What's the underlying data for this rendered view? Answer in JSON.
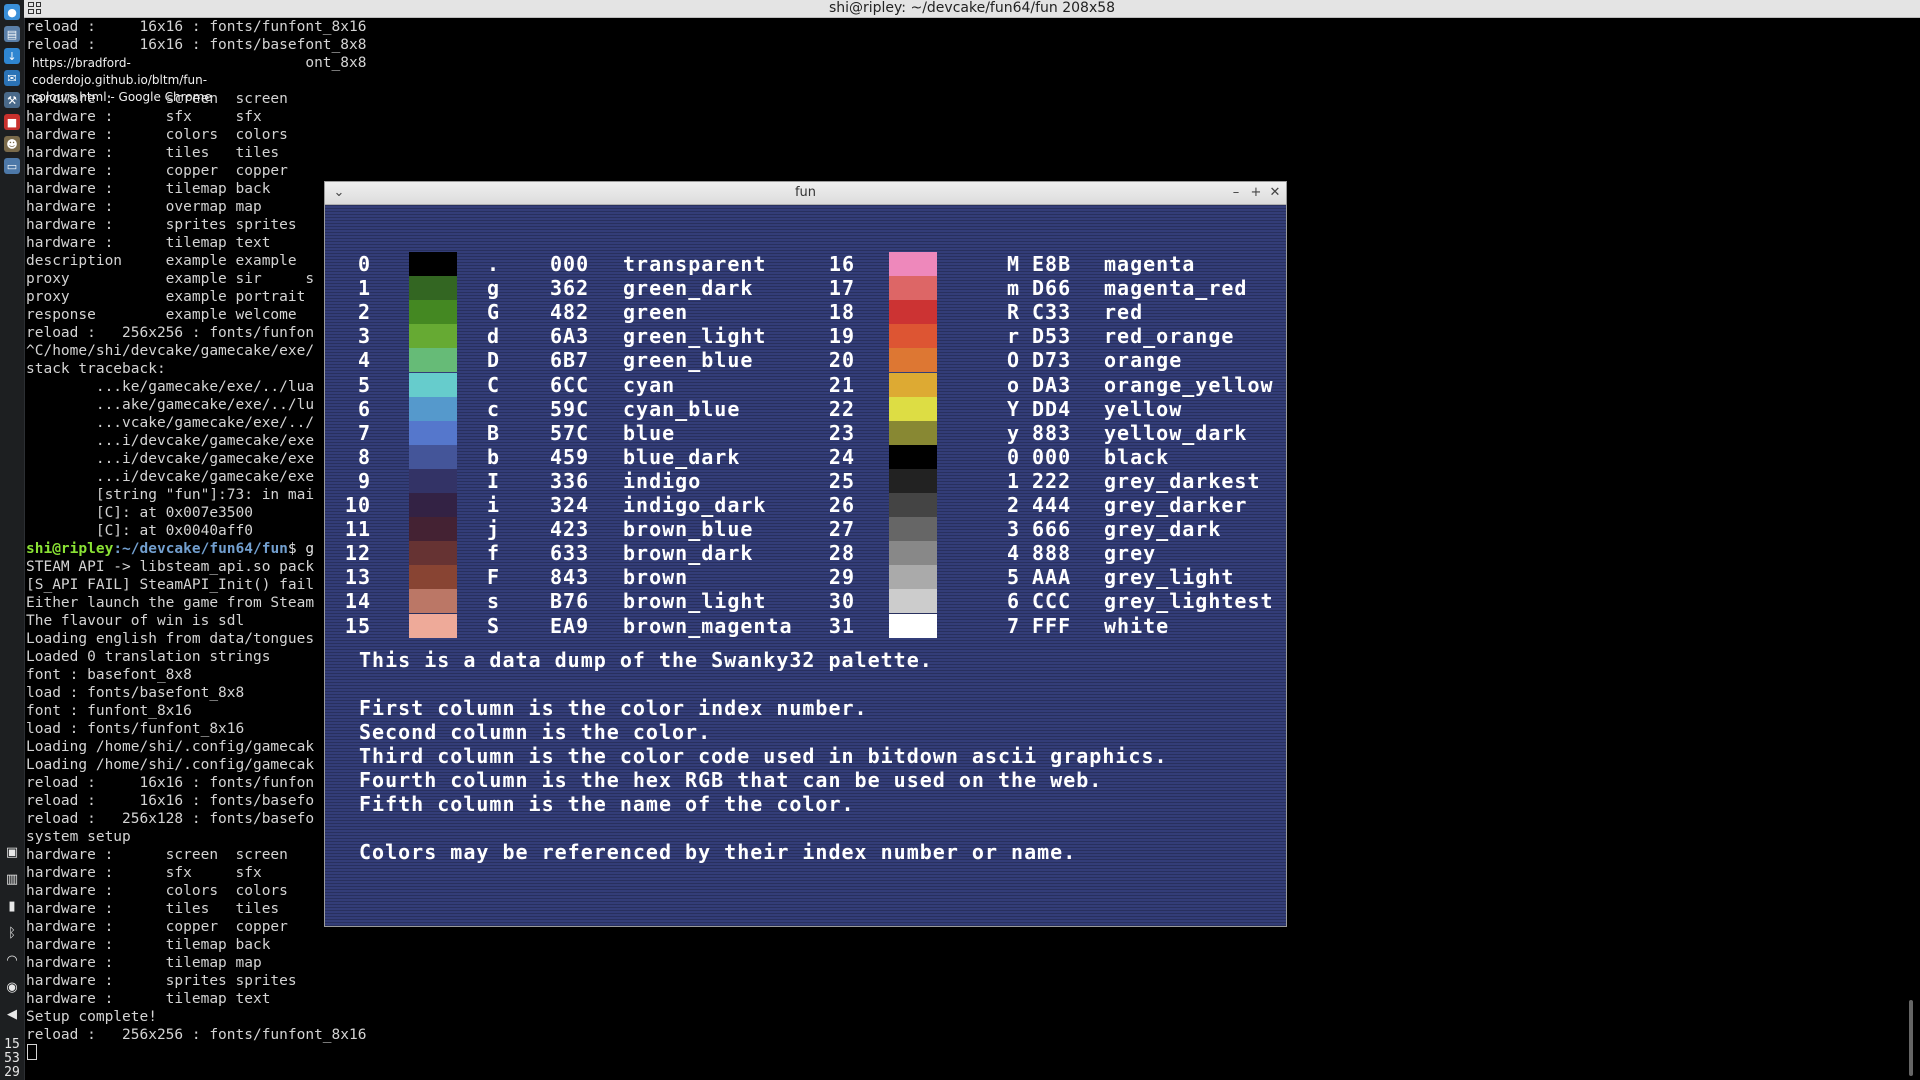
{
  "terminal": {
    "title": "shi@ripley: ~/devcake/fun64/fun 208x58",
    "lines": [
      "reload :     16x16 : fonts/funfont_8x16",
      "reload :     16x16 : fonts/basefont_8x8",
      "reload :   256x128 : fonts/basefont_8x8",
      "system setup",
      "hardware :      screen  screen",
      "hardware :      sfx     sfx",
      "hardware :      colors  colors",
      "hardware :      tiles   tiles",
      "hardware :      copper  copper",
      "hardware :      tilemap back",
      "hardware :      overmap map",
      "hardware :      sprites sprites",
      "hardware :      tilemap text",
      "description     example example",
      "proxy           example sir     s",
      "proxy           example portrait",
      "response        example welcome",
      "reload :   256x256 : fonts/funfon",
      "^C/home/shi/devcake/gamecake/exe/",
      "stack traceback:",
      "        ...ke/gamecake/exe/../lua",
      "        ...ake/gamecake/exe/../lu",
      "        ...vcake/gamecake/exe/../",
      "        ...i/devcake/gamecake/exe",
      "        ...i/devcake/gamecake/exe",
      "        ...i/devcake/gamecake/exe",
      "        [string \"fun\"]:73: in mai",
      "        [C]: at 0x007e3500",
      "        [C]: at 0x0040aff0",
      "",
      "STEAM API -> libsteam_api.so pack",
      "[S_API FAIL] SteamAPI_Init() fail",
      "Either launch the game from Steam",
      "The flavour of win is sdl",
      "Loading english from data/tongues",
      "Loaded 0 translation strings",
      "font : basefont_8x8",
      "load : fonts/basefont_8x8",
      "font : funfont_8x16",
      "load : fonts/funfont_8x16",
      "Loading /home/shi/.config/gamecak",
      "Loading /home/shi/.config/gamecak",
      "reload :     16x16 : fonts/funfon",
      "reload :     16x16 : fonts/basefo",
      "reload :   256x128 : fonts/basefo",
      "system setup",
      "hardware :      screen  screen",
      "hardware :      sfx     sfx",
      "hardware :      colors  colors",
      "hardware :      tiles   tiles",
      "hardware :      copper  copper",
      "hardware :      tilemap back",
      "hardware :      tilemap map",
      "hardware :      sprites sprites",
      "hardware :      tilemap text",
      "Setup complete!",
      "reload :   256x256 : fonts/funfont_8x16",
      ""
    ],
    "prompt": {
      "user_host": "shi@ripley",
      "path": ":~/devcake/fun64/fun",
      "rest": "$ g"
    }
  },
  "tooltip": {
    "line1": "https://bradford-coderdojo.github.io/bltm/fun-",
    "line2": "colours.html - Google Chrome"
  },
  "clock": {
    "hour": "15",
    "minute": "53",
    "second": "29"
  },
  "fun_window": {
    "title": "fun",
    "info_lines": [
      "This is a data dump of the Swanky32 palette.",
      "",
      "First column is the color index number.",
      "Second column is the color.",
      "Third column is the color code used in bitdown ascii graphics.",
      "Fourth column is the hex RGB that can be used on the web.",
      "Fifth column is the name of the color.",
      "",
      "Colors may be referenced by their index number or name."
    ],
    "palette": [
      {
        "index": "0",
        "code": ".",
        "hex": "000",
        "name": "transparent",
        "color": "#000000"
      },
      {
        "index": "1",
        "code": "g",
        "hex": "362",
        "name": "green_dark",
        "color": "#336622"
      },
      {
        "index": "2",
        "code": "G",
        "hex": "482",
        "name": "green",
        "color": "#448822"
      },
      {
        "index": "3",
        "code": "d",
        "hex": "6A3",
        "name": "green_light",
        "color": "#66aa33"
      },
      {
        "index": "4",
        "code": "D",
        "hex": "6B7",
        "name": "green_blue",
        "color": "#66bb77"
      },
      {
        "index": "5",
        "code": "C",
        "hex": "6CC",
        "name": "cyan",
        "color": "#66cccc"
      },
      {
        "index": "6",
        "code": "c",
        "hex": "59C",
        "name": "cyan_blue",
        "color": "#5599cc"
      },
      {
        "index": "7",
        "code": "B",
        "hex": "57C",
        "name": "blue",
        "color": "#5577cc"
      },
      {
        "index": "8",
        "code": "b",
        "hex": "459",
        "name": "blue_dark",
        "color": "#445599"
      },
      {
        "index": "9",
        "code": "I",
        "hex": "336",
        "name": "indigo",
        "color": "#333366"
      },
      {
        "index": "10",
        "code": "i",
        "hex": "324",
        "name": "indigo_dark",
        "color": "#332244"
      },
      {
        "index": "11",
        "code": "j",
        "hex": "423",
        "name": "brown_blue",
        "color": "#442233"
      },
      {
        "index": "12",
        "code": "f",
        "hex": "633",
        "name": "brown_dark",
        "color": "#663333"
      },
      {
        "index": "13",
        "code": "F",
        "hex": "843",
        "name": "brown",
        "color": "#884433"
      },
      {
        "index": "14",
        "code": "s",
        "hex": "B76",
        "name": "brown_light",
        "color": "#bb7766"
      },
      {
        "index": "15",
        "code": "S",
        "hex": "EA9",
        "name": "brown_magenta",
        "color": "#eeaa99"
      },
      {
        "index": "16",
        "code": "M",
        "hex": "E8B",
        "name": "magenta",
        "color": "#ee88bb"
      },
      {
        "index": "17",
        "code": "m",
        "hex": "D66",
        "name": "magenta_red",
        "color": "#dd6666"
      },
      {
        "index": "18",
        "code": "R",
        "hex": "C33",
        "name": "red",
        "color": "#cc3333"
      },
      {
        "index": "19",
        "code": "r",
        "hex": "D53",
        "name": "red_orange",
        "color": "#dd5533"
      },
      {
        "index": "20",
        "code": "O",
        "hex": "D73",
        "name": "orange",
        "color": "#dd7733"
      },
      {
        "index": "21",
        "code": "o",
        "hex": "DA3",
        "name": "orange_yellow",
        "color": "#ddaa33"
      },
      {
        "index": "22",
        "code": "Y",
        "hex": "DD4",
        "name": "yellow",
        "color": "#dddd44"
      },
      {
        "index": "23",
        "code": "y",
        "hex": "883",
        "name": "yellow_dark",
        "color": "#888833"
      },
      {
        "index": "24",
        "code": "0",
        "hex": "000",
        "name": "black",
        "color": "#000000"
      },
      {
        "index": "25",
        "code": "1",
        "hex": "222",
        "name": "grey_darkest",
        "color": "#222222"
      },
      {
        "index": "26",
        "code": "2",
        "hex": "444",
        "name": "grey_darker",
        "color": "#444444"
      },
      {
        "index": "27",
        "code": "3",
        "hex": "666",
        "name": "grey_dark",
        "color": "#666666"
      },
      {
        "index": "28",
        "code": "4",
        "hex": "888",
        "name": "grey",
        "color": "#888888"
      },
      {
        "index": "29",
        "code": "5",
        "hex": "AAA",
        "name": "grey_light",
        "color": "#aaaaaa"
      },
      {
        "index": "30",
        "code": "6",
        "hex": "CCC",
        "name": "grey_lightest",
        "color": "#cccccc"
      },
      {
        "index": "31",
        "code": "7",
        "hex": "FFF",
        "name": "white",
        "color": "#ffffff"
      }
    ]
  },
  "dock": {
    "icons": [
      {
        "name": "chrome-icon",
        "color": "#3a8fd8",
        "glyph": "●"
      },
      {
        "name": "files-icon",
        "color": "#5a7fa8",
        "glyph": "▤"
      },
      {
        "name": "download-icon",
        "color": "#2f86d1",
        "glyph": "↓"
      },
      {
        "name": "thunderbird-icon",
        "color": "#2b73b6",
        "glyph": "✉"
      },
      {
        "name": "tool-icon",
        "color": "#4a6a8a",
        "glyph": "⚒"
      },
      {
        "name": "red-app-icon",
        "color": "#c8312d",
        "glyph": "■"
      },
      {
        "name": "gimp-icon",
        "color": "#7a6a4a",
        "glyph": "☻"
      },
      {
        "name": "window-icon",
        "color": "#4d78a8",
        "glyph": "▭"
      }
    ],
    "tray_icons": [
      {
        "name": "screenshot-icon",
        "glyph": "▣"
      },
      {
        "name": "storage-icon",
        "glyph": "▥"
      },
      {
        "name": "battery-icon",
        "glyph": "▮"
      },
      {
        "name": "bluetooth-icon",
        "glyph": "ᛒ"
      },
      {
        "name": "wifi-icon",
        "glyph": "◠"
      },
      {
        "name": "steam-icon",
        "glyph": "◉"
      },
      {
        "name": "volume-icon",
        "glyph": "◀"
      }
    ]
  }
}
